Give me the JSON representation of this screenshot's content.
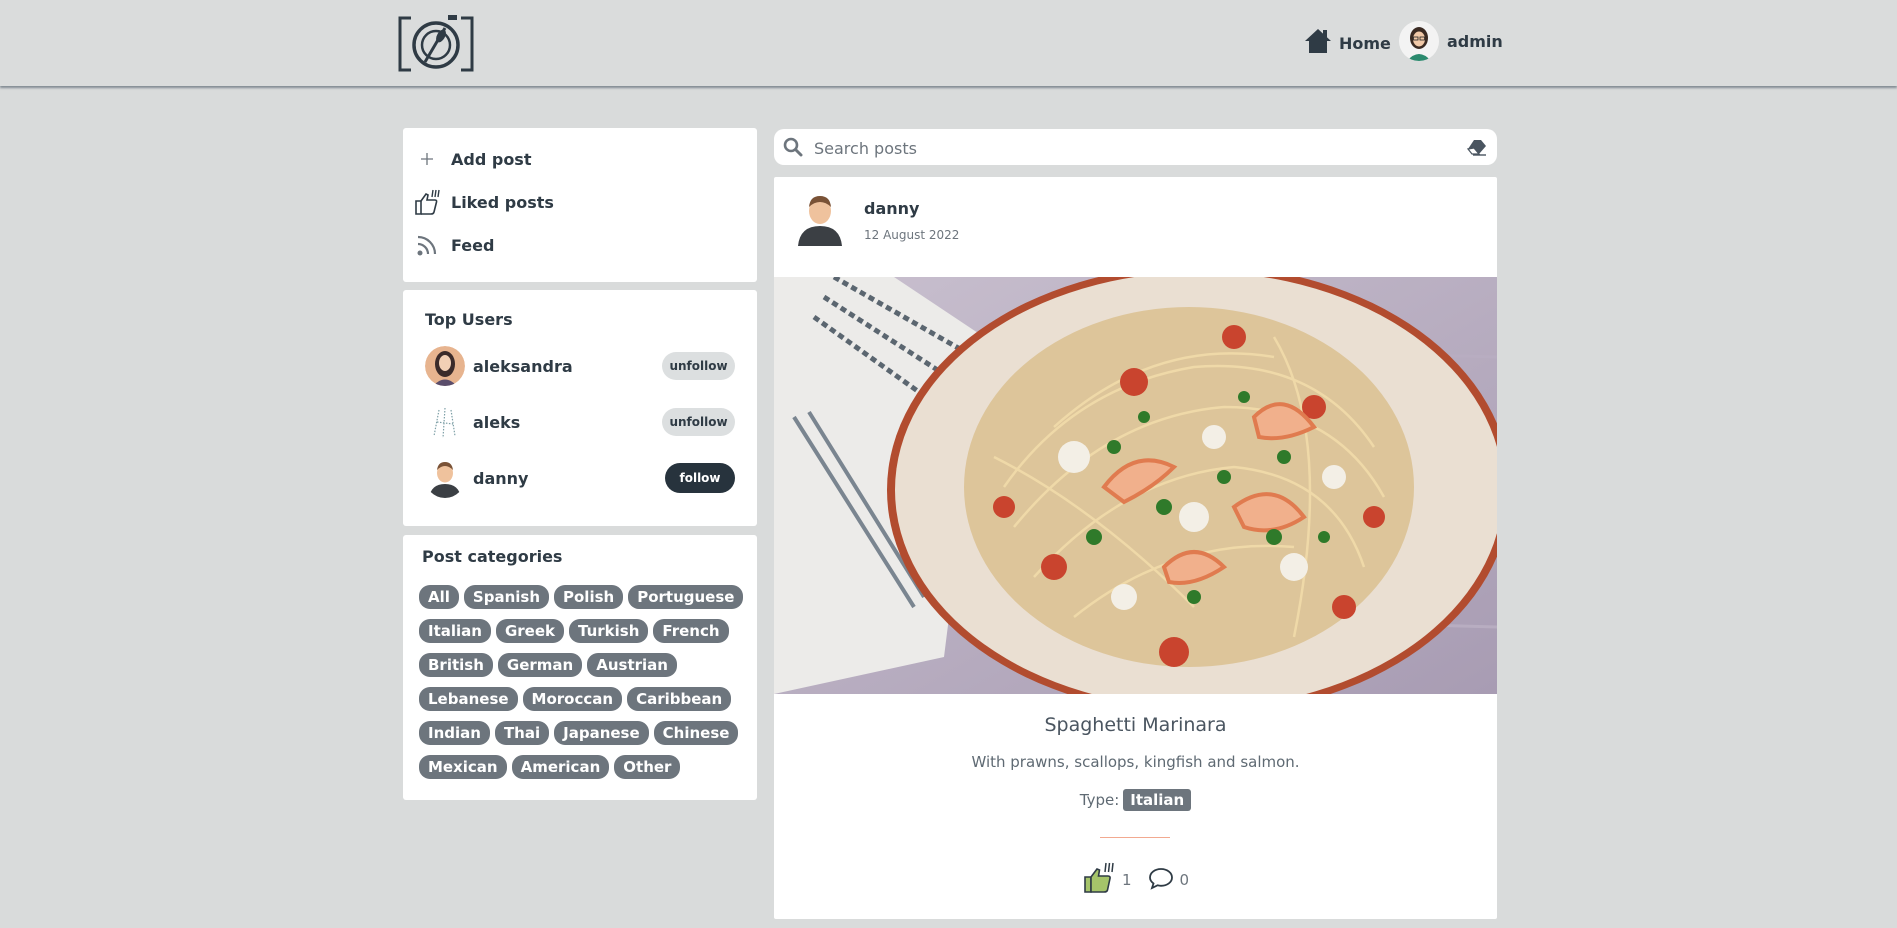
{
  "header": {
    "home_label": "Home",
    "user_label": "admin",
    "icons": {
      "logo": "camera-food-logo",
      "home": "home-icon",
      "user_avatar": "admin-avatar"
    }
  },
  "actions": {
    "add_post": "Add post",
    "liked_posts": "Liked posts",
    "feed": "Feed",
    "icons": [
      "plus-icon",
      "thumbs-up-fork-icon",
      "rss-feed-icon"
    ]
  },
  "top_users": {
    "title": "Top Users",
    "users": [
      {
        "name": "aleksandra",
        "action": "unfollow"
      },
      {
        "name": "aleks",
        "action": "unfollow"
      },
      {
        "name": "danny",
        "action": "follow"
      }
    ]
  },
  "categories": {
    "title": "Post categories",
    "rows": [
      [
        "All",
        "Spanish",
        "Polish",
        "Portuguese"
      ],
      [
        "Italian",
        "Greek",
        "Turkish",
        "French"
      ],
      [
        "British",
        "German",
        "Austrian"
      ],
      [
        "Lebanese",
        "Moroccan",
        "Caribbean"
      ],
      [
        "Indian",
        "Thai",
        "Japanese",
        "Chinese"
      ],
      [
        "Mexican",
        "American",
        "Other"
      ]
    ]
  },
  "search": {
    "placeholder": "Search posts",
    "value": ""
  },
  "post": {
    "author": "danny",
    "date": "12 August 2022",
    "title": "Spaghetti Marinara",
    "description": "With prawns, scallops, kingfish and salmon.",
    "type_label": "Type:",
    "type_value": "Italian",
    "likes": "1",
    "comments": "0"
  },
  "colors": {
    "background": "#d9dbdb",
    "card": "#ffffff",
    "text_dark": "#2f3b45",
    "tag": "#6d757d",
    "follow_button": "#27333d",
    "unfollow_button": "#dcdfe0",
    "divider": "#f2a990"
  }
}
